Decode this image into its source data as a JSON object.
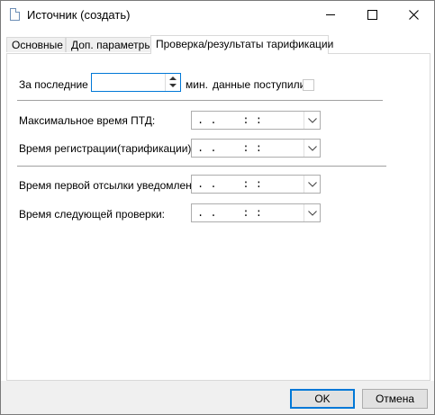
{
  "window": {
    "title": "Источник (создать)"
  },
  "tabs": [
    {
      "label": "Основные",
      "active": false
    },
    {
      "label": "Доп. параметры",
      "active": false
    },
    {
      "label": "Проверка/результаты тарификации",
      "active": true
    }
  ],
  "form": {
    "last_label": "За последние",
    "last_value": "",
    "minutes_label": "мин.",
    "data_received_label": "данные поступили:",
    "data_received_checked": false,
    "max_ptd_label": "Максимальное время ПТД:",
    "max_ptd_value": ". .    : :",
    "registration_label": "Время регистрации(тарификации):",
    "registration_value": ". .    : :",
    "first_notify_label": "Время первой отсылки уведомления:",
    "first_notify_value": ". .    : :",
    "next_check_label": "Время следующей проверки:",
    "next_check_value": ". .    : :"
  },
  "buttons": {
    "ok": "OK",
    "cancel": "Отмена"
  },
  "icons": {
    "window": "document-icon",
    "minimize": "minimize-icon",
    "maximize": "maximize-icon",
    "close": "close-icon",
    "spinner": "spinner-icon",
    "dropdown": "chevron-down-icon"
  }
}
